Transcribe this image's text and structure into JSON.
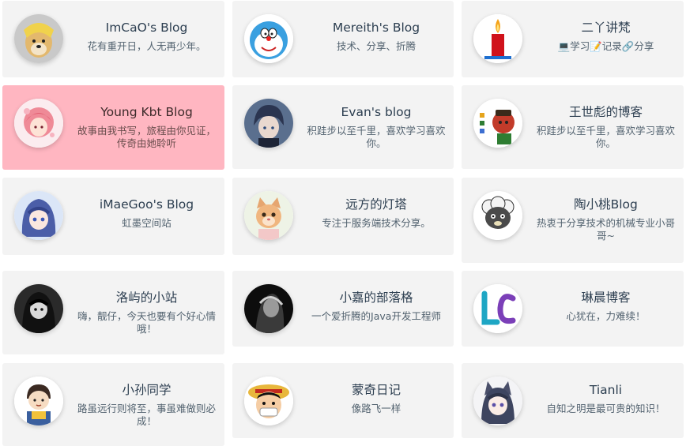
{
  "links": [
    {
      "name": "ImCaO's Blog",
      "desc": "花有重开日，人无再少年。",
      "avatar": "shiba-dog-avatar"
    },
    {
      "name": "Mereith's Blog",
      "desc": "技术、分享、折腾",
      "avatar": "doraemon-avatar"
    },
    {
      "name": "二丫讲梵",
      "desc": "💻学习📝记录🔗分享",
      "avatar": "candle-avatar"
    },
    {
      "name": "Young Kbt Blog",
      "desc": "故事由我书写，旅程由你见证，传奇由她聆听",
      "avatar": "pink-anime-girl-avatar"
    },
    {
      "name": "Evan's blog",
      "desc": "积跬步以至千里，喜欢学习喜欢你。",
      "avatar": "anime-boy-avatar"
    },
    {
      "name": "王世彪的博客",
      "desc": "积跬步以至千里，喜欢学习喜欢你。",
      "avatar": "cartoon-character-avatar"
    },
    {
      "name": "iMaeGoo's Blog",
      "desc": "虹墨空间站",
      "avatar": "blue-hair-anime-avatar"
    },
    {
      "name": "远方的灯塔",
      "desc": "专注于服务端技术分享。",
      "avatar": "kitten-avatar"
    },
    {
      "name": "陶小桃Blog",
      "desc": "热衷于分享技术的机械专业小哥哥~",
      "avatar": "sheep-cartoon-avatar"
    },
    {
      "name": "洛屿的小站",
      "desc": "嗨，靓仔，今天也要有个好心情哦！",
      "avatar": "dark-anime-girl-avatar"
    },
    {
      "name": "小嘉的部落格",
      "desc": "一个爱折腾的Java开发工程师",
      "avatar": "monochrome-portrait-avatar"
    },
    {
      "name": "琳晨博客",
      "desc": "心犹在，力难续！",
      "avatar": "lc-logo-avatar"
    },
    {
      "name": "小孙同学",
      "desc": "路虽远行则将至，事虽难做则必成！",
      "avatar": "cartoon-boy-avatar"
    },
    {
      "name": "蒙奇日记",
      "desc": "像路飞一样",
      "avatar": "luffy-avatar"
    },
    {
      "name": "Tianli",
      "desc": "自知之明是最可贵的知识！",
      "avatar": "cat-ear-anime-avatar"
    }
  ],
  "colors": {
    "card_bg": "#f3f3f3",
    "card_active_bg": "#ffb6c1",
    "title_text": "#2c3e50"
  }
}
